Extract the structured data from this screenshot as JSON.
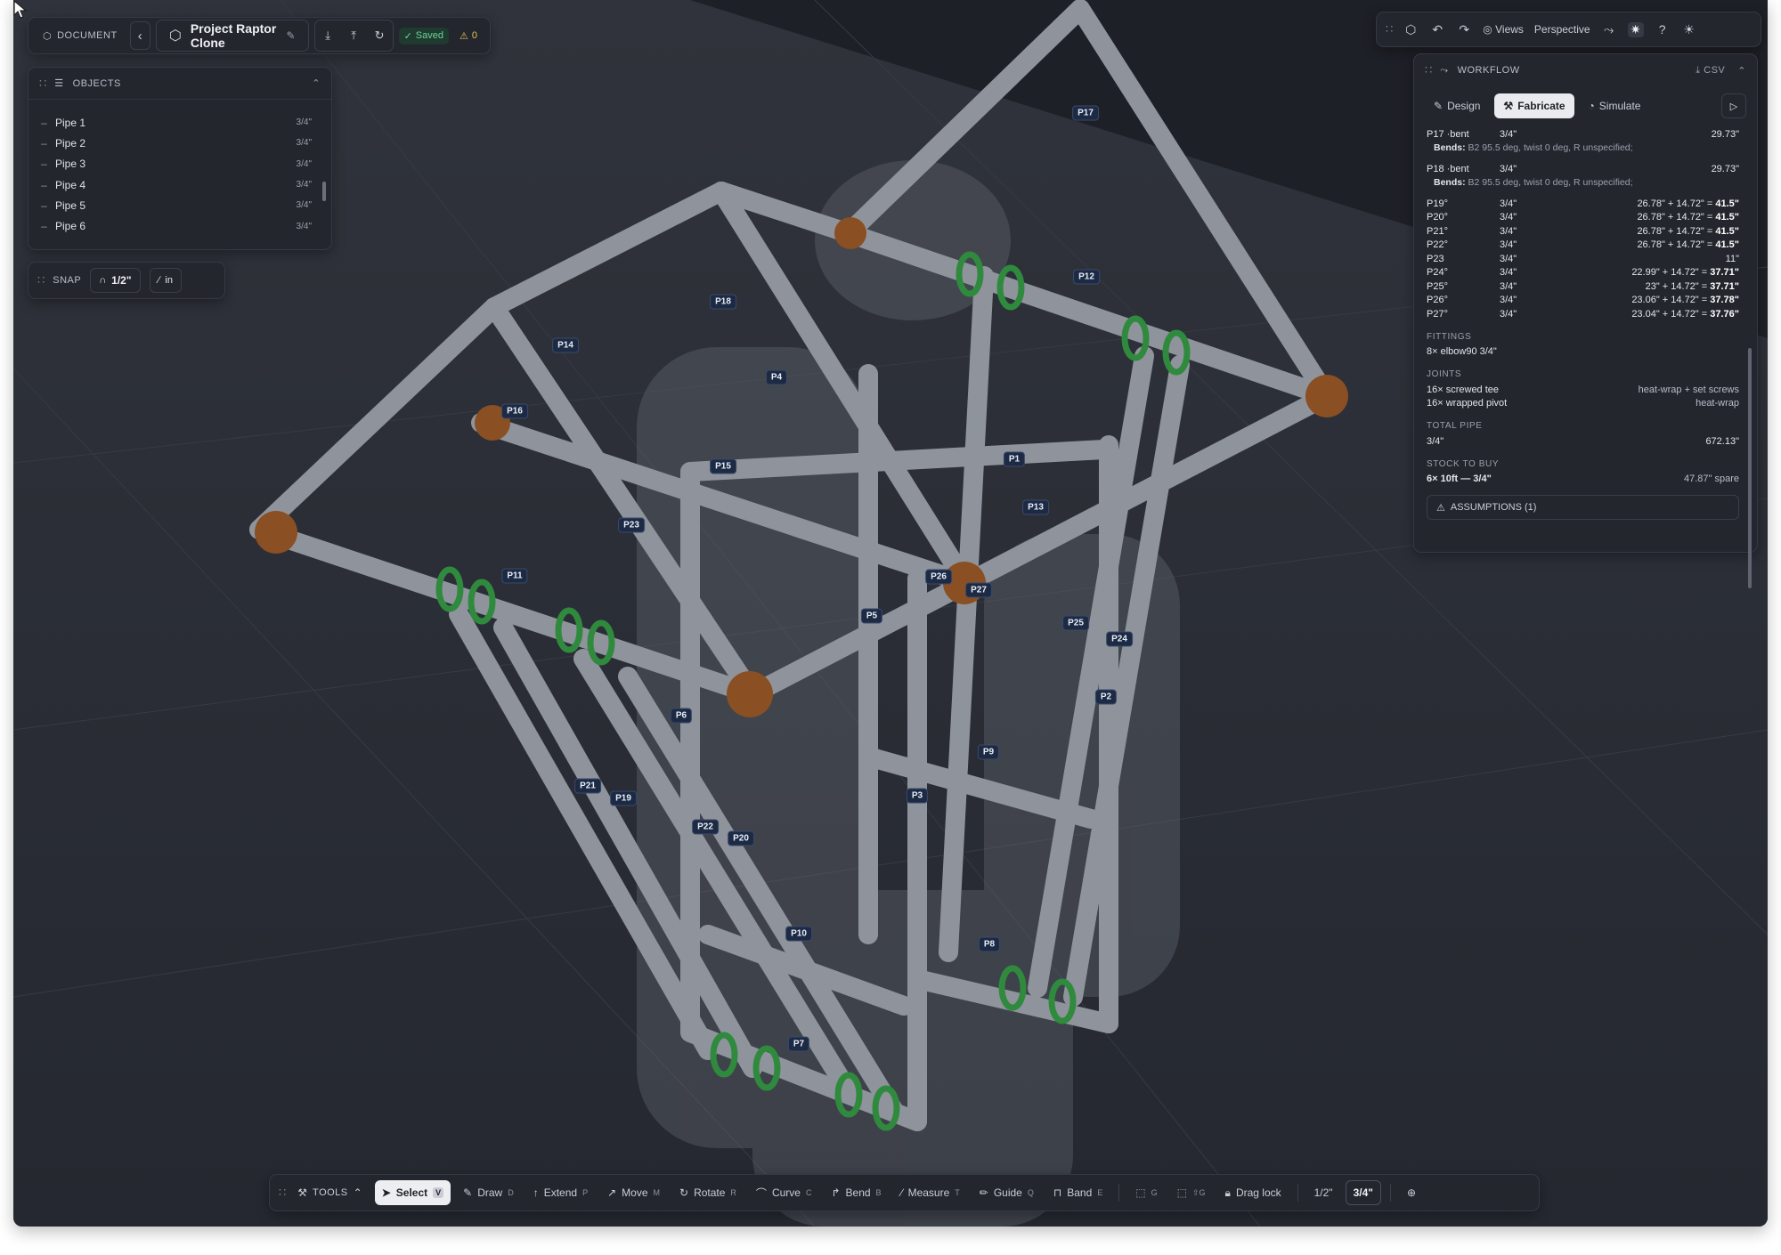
{
  "header": {
    "section_label": "DOCUMENT",
    "doc_title": "Project Raptor Clone",
    "saved_label": "Saved",
    "warnings_count": "0"
  },
  "objects_panel": {
    "title": "OBJECTS",
    "items": [
      {
        "label": "Pipe 1",
        "size": "3/4\""
      },
      {
        "label": "Pipe 2",
        "size": "3/4\""
      },
      {
        "label": "Pipe 3",
        "size": "3/4\""
      },
      {
        "label": "Pipe 4",
        "size": "3/4\""
      },
      {
        "label": "Pipe 5",
        "size": "3/4\""
      },
      {
        "label": "Pipe 6",
        "size": "3/4\""
      }
    ]
  },
  "snap_panel": {
    "label": "SNAP",
    "value": "1/2\"",
    "unit": "in"
  },
  "top_toolbar": {
    "views_label": "Views",
    "projection_label": "Perspective"
  },
  "workflow": {
    "title": "WORKFLOW",
    "export_label": "CSV",
    "tabs": [
      "Design",
      "Fabricate",
      "Simulate"
    ],
    "active_tab": "Fabricate",
    "bent_pipes": [
      {
        "name": "P17 ·bent",
        "size": "3/4\"",
        "length": "29.73\"",
        "bends_label": "Bends:",
        "bends": "B2 95.5 deg, twist 0 deg, R unspecified;"
      },
      {
        "name": "P18 ·bent",
        "size": "3/4\"",
        "length": "29.73\"",
        "bends_label": "Bends:",
        "bends": "B2 95.5 deg, twist 0 deg, R unspecified;"
      }
    ],
    "cuts": [
      {
        "name": "P19°",
        "size": "3/4\"",
        "formula": "26.78\" + 14.72\" = ",
        "total": "41.5\""
      },
      {
        "name": "P20°",
        "size": "3/4\"",
        "formula": "26.78\" + 14.72\" = ",
        "total": "41.5\""
      },
      {
        "name": "P21°",
        "size": "3/4\"",
        "formula": "26.78\" + 14.72\" = ",
        "total": "41.5\""
      },
      {
        "name": "P22°",
        "size": "3/4\"",
        "formula": "26.78\" + 14.72\" = ",
        "total": "41.5\""
      },
      {
        "name": "P23",
        "size": "3/4\"",
        "formula": "",
        "total": "11\""
      },
      {
        "name": "P24°",
        "size": "3/4\"",
        "formula": "22.99\" + 14.72\" = ",
        "total": "37.71\""
      },
      {
        "name": "P25°",
        "size": "3/4\"",
        "formula": "23\" + 14.72\" = ",
        "total": "37.71\""
      },
      {
        "name": "P26°",
        "size": "3/4\"",
        "formula": "23.06\" + 14.72\" = ",
        "total": "37.78\""
      },
      {
        "name": "P27°",
        "size": "3/4\"",
        "formula": "23.04\" + 14.72\" = ",
        "total": "37.76\""
      }
    ],
    "fittings_title": "FITTINGS",
    "fittings": "8× elbow90 3/4\"",
    "joints_title": "JOINTS",
    "joints": [
      {
        "label": "16× screwed tee",
        "note": "heat-wrap + set screws"
      },
      {
        "label": "16× wrapped pivot",
        "note": "heat-wrap"
      }
    ],
    "total_pipe_title": "TOTAL PIPE",
    "total_pipe": {
      "size": "3/4\"",
      "length": "672.13\""
    },
    "stock_title": "STOCK TO BUY",
    "stock": {
      "label": "6× 10ft — 3/4\"",
      "spare": "47.87\" spare"
    },
    "assumptions_label": "ASSUMPTIONS (1)"
  },
  "tools_bar": {
    "title": "TOOLS",
    "tools": [
      {
        "label": "Select",
        "key": "V"
      },
      {
        "label": "Draw",
        "key": "D"
      },
      {
        "label": "Extend",
        "key": "P"
      },
      {
        "label": "Move",
        "key": "M"
      },
      {
        "label": "Rotate",
        "key": "R"
      },
      {
        "label": "Curve",
        "key": "C"
      },
      {
        "label": "Bend",
        "key": "B"
      },
      {
        "label": "Measure",
        "key": "T"
      },
      {
        "label": "Guide",
        "key": "Q"
      },
      {
        "label": "Band",
        "key": "E"
      }
    ],
    "group_key": "G",
    "ungroup_key": "⇧G",
    "drag_lock_label": "Drag lock",
    "size_options": [
      "1/2\"",
      "3/4\""
    ],
    "active_size": "3/4\""
  },
  "pipe_labels": [
    "P1",
    "P2",
    "P3",
    "P4",
    "P5",
    "P6",
    "P7",
    "P8",
    "P9",
    "P10",
    "P11",
    "P12",
    "P13",
    "P14",
    "P15",
    "P16",
    "P17",
    "P18",
    "P19",
    "P20",
    "P21",
    "P22",
    "P23",
    "P24",
    "P25",
    "P26",
    "P27"
  ],
  "colors": {
    "pipe": "#8f949c",
    "elbow": "#8a4f22",
    "clamp": "#2f8a3e",
    "label_bg": "#1d2a44",
    "active_tab_bg": "#e9ebef"
  }
}
